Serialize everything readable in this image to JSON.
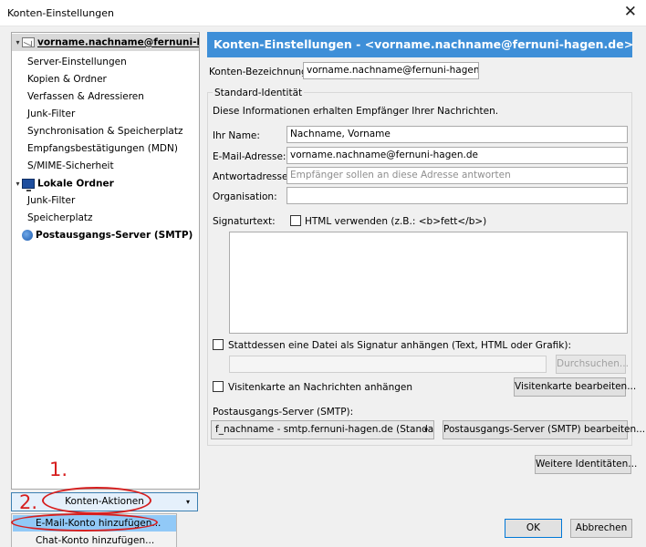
{
  "window": {
    "title": "Konten-Einstellungen"
  },
  "tree": {
    "account": "vorname.nachname@fernuni-hag...",
    "account_items": [
      "Server-Einstellungen",
      "Kopien & Ordner",
      "Verfassen & Adressieren",
      "Junk-Filter",
      "Synchronisation & Speicherplatz",
      "Empfangsbestätigungen (MDN)",
      "S/MIME-Sicherheit"
    ],
    "local_folders": "Lokale Ordner",
    "local_items": [
      "Junk-Filter",
      "Speicherplatz"
    ],
    "smtp": "Postausgangs-Server (SMTP)"
  },
  "account_actions": {
    "label": "Konten-Aktionen",
    "menu": [
      "E-Mail-Konto hinzufügen...",
      "Chat-Konto hinzufügen..."
    ]
  },
  "annotations": {
    "step1": "1.",
    "step2": "2."
  },
  "panel": {
    "header": "Konten-Einstellungen - <vorname.nachname@fernuni-hagen.de>",
    "account_name_label": "Konten-Bezeichnung:",
    "account_name_value": "vorname.nachname@fernuni-hagen.de",
    "identity_legend": "Standard-Identität",
    "identity_info": "Diese Informationen erhalten Empfänger Ihrer Nachrichten.",
    "name_label": "Ihr Name:",
    "name_value": "Nachname, Vorname",
    "email_label": "E-Mail-Adresse:",
    "email_value": "vorname.nachname@fernuni-hagen.de",
    "reply_label": "Antwortadresse:",
    "reply_placeholder": "Empfänger sollen an diese Adresse antworten",
    "org_label": "Organisation:",
    "org_value": "",
    "sig_label": "Signaturtext:",
    "html_label": "HTML verwenden (z.B.: <b>fett</b>)",
    "attach_sig_label": "Stattdessen eine Datei als Signatur anhängen (Text, HTML oder Grafik):",
    "browse_button": "Durchsuchen...",
    "vcard_label": "Visitenkarte an Nachrichten anhängen",
    "vcard_button": "Visitenkarte bearbeiten...",
    "smtp_label": "Postausgangs-Server (SMTP):",
    "smtp_value": "f_nachname - smtp.fernuni-hagen.de (Standard)",
    "smtp_edit_button": "Postausgangs-Server (SMTP) bearbeiten...",
    "more_identities_button": "Weitere Identitäten...",
    "ok_button": "OK",
    "cancel_button": "Abbrechen"
  },
  "colors": {
    "header_bg": "#3e8fd8",
    "annotation_red": "#d61f1f",
    "menu_highlight": "#91c9f7"
  }
}
